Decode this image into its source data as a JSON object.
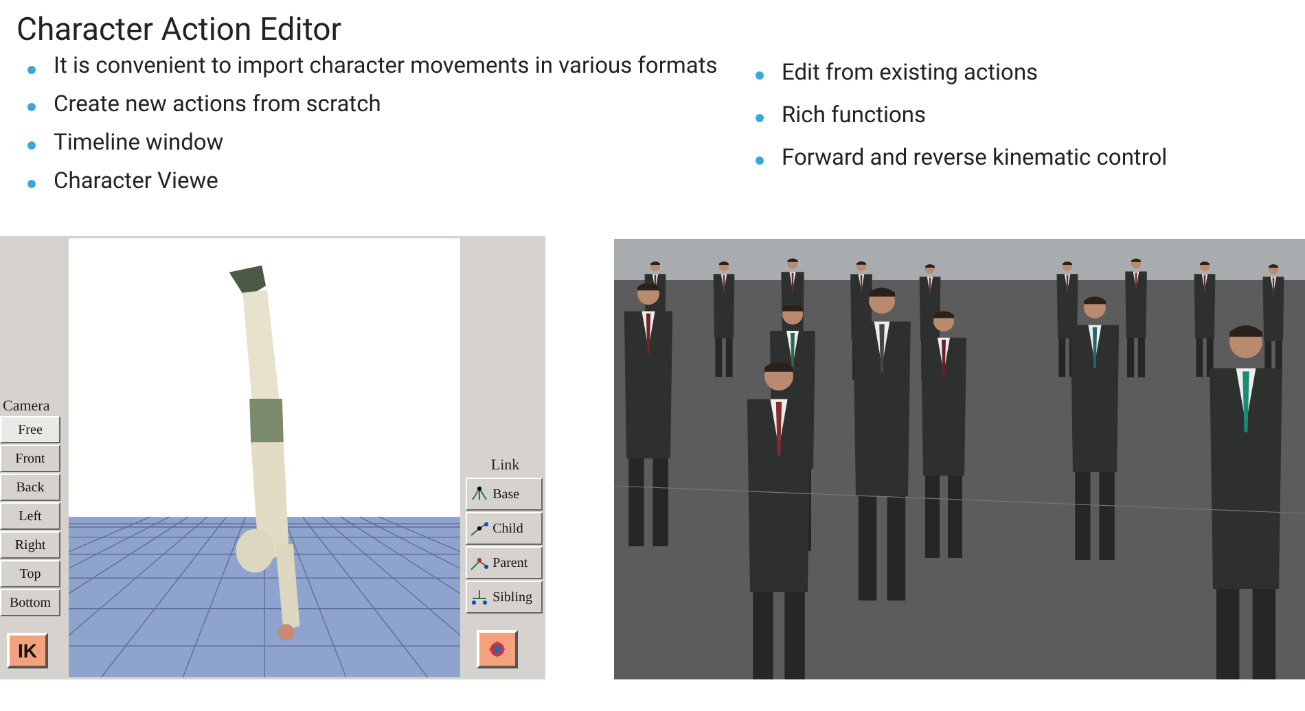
{
  "title": "Character Action Editor",
  "bullets_left": [
    "It is convenient to import character movements in various formats",
    "Create new actions from scratch",
    "Timeline window",
    "Character Viewe"
  ],
  "bullets_right": [
    "Edit from existing actions",
    "Rich functions",
    " Forward and reverse kinematic control"
  ],
  "editor": {
    "viewport": {
      "kind": "picture"
    },
    "camera": {
      "label": "Camera",
      "buttons": [
        {
          "label": "Free",
          "selected": true
        },
        {
          "label": "Front",
          "selected": false
        },
        {
          "label": "Back",
          "selected": false
        },
        {
          "label": "Left",
          "selected": false
        },
        {
          "label": "Right",
          "selected": false
        },
        {
          "label": "Top",
          "selected": false
        },
        {
          "label": "Bottom",
          "selected": false
        }
      ]
    },
    "ik_button": "IK",
    "link": {
      "label": "Link",
      "buttons": [
        {
          "label": "Base",
          "kind": "base"
        },
        {
          "label": "Child",
          "kind": "child"
        },
        {
          "label": "Parent",
          "kind": "parent"
        },
        {
          "label": "Sibling",
          "kind": "sibling"
        }
      ]
    }
  },
  "render": {
    "kind": "picture"
  }
}
